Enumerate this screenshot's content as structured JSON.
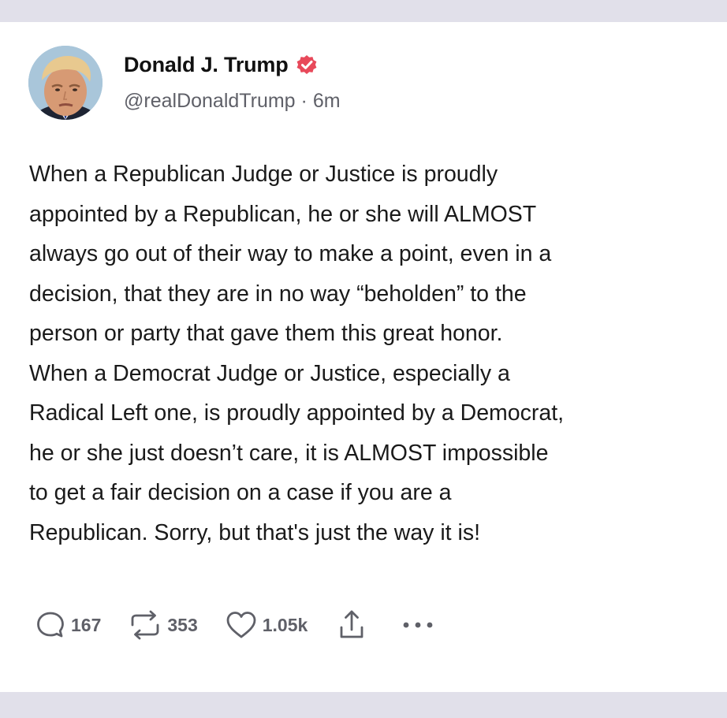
{
  "post": {
    "author": {
      "display_name": "Donald J. Trump",
      "handle": "@realDonaldTrump",
      "separator": "·",
      "time_ago": "6m",
      "avatar_icon": "profile-photo",
      "verified_icon": "verified-badge-icon"
    },
    "body": "When a Republican Judge or Justice is proudly\nappointed by a Republican, he or she will ALMOST\nalways go out of their way to make a point, even in a\ndecision, that they are in no way “beholden” to the\nperson or party that gave them this great honor.\nWhen a Democrat Judge or Justice, especially a\nRadical Left one, is proudly appointed by a Democrat,\nhe or she just doesn’t care, it is ALMOST impossible\nto get a fair decision on a case if you are a\nRepublican. Sorry, but that's just the way it is!",
    "actions": {
      "replies": {
        "icon": "reply-icon",
        "count": "167"
      },
      "reposts": {
        "icon": "repost-icon",
        "count": "353"
      },
      "likes": {
        "icon": "heart-icon",
        "count": "1.05k"
      },
      "share": {
        "icon": "share-icon"
      },
      "more": {
        "icon": "more-icon"
      }
    }
  },
  "colors": {
    "verified_badge": "#e8495a",
    "text_primary": "#111111",
    "text_secondary": "#5f6068",
    "background_band": "#e1e0ea"
  }
}
